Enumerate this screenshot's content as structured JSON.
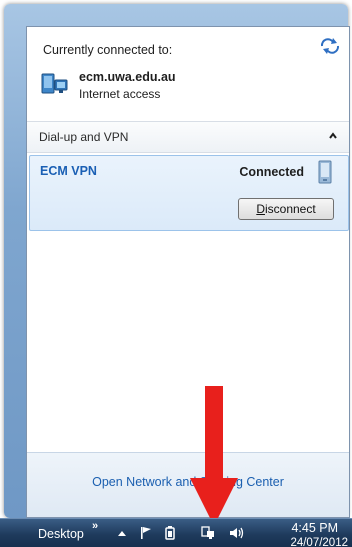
{
  "network_flyout": {
    "currently_connected_label": "Currently connected to:",
    "network": {
      "name": "ecm.uwa.edu.au",
      "status": "Internet access",
      "icon": "network-connection-icon"
    },
    "dialup_section": {
      "title": "Dial-up and VPN",
      "collapse_icon": "chevron-up-icon",
      "vpn": {
        "name": "ECM VPN",
        "status": "Connected",
        "icon": "vpn-connection-icon",
        "disconnect_label_underlined": "D",
        "disconnect_label_rest": "isconnect"
      }
    },
    "footer_link": "Open Network and Sharing Center",
    "refresh_icon": "refresh-icon"
  },
  "annotation": {
    "arrow_color": "#e8201c"
  },
  "taskbar": {
    "desktop_label": "Desktop",
    "overflow_chevron": "»",
    "tray_icons": [
      "show-hidden-icons-chevron-icon",
      "action-center-flag-icon",
      "power-icon",
      "network-icon",
      "volume-icon"
    ],
    "clock": {
      "time": "4:45 PM",
      "date": "24/07/2012"
    }
  },
  "colors": {
    "link_blue": "#1b5fb0",
    "vpn_name_blue": "#1a5fb4",
    "selection_bg": "#dbeaf9",
    "taskbar_bg": "#1e3a5c"
  }
}
